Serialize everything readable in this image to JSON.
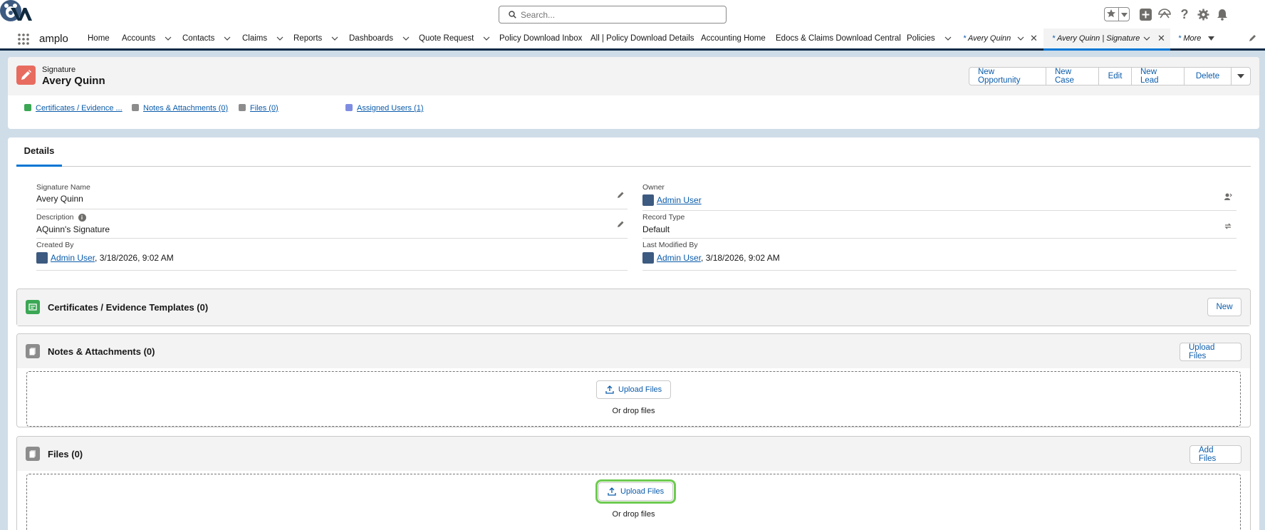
{
  "header": {
    "search_placeholder": "Search...",
    "icons": [
      "favorites-star-icon",
      "chevron-down-icon",
      "add-icon",
      "trailhead-icon",
      "help-icon",
      "setup-gear-icon",
      "notifications-bell-icon",
      "user-avatar"
    ]
  },
  "nav": {
    "app_name": "amplo",
    "items": [
      {
        "label": "Home",
        "dropdown": false
      },
      {
        "label": "Accounts",
        "dropdown": true
      },
      {
        "label": "Contacts",
        "dropdown": true
      },
      {
        "label": "Claims",
        "dropdown": true
      },
      {
        "label": "Reports",
        "dropdown": true
      },
      {
        "label": "Dashboards",
        "dropdown": true
      },
      {
        "label": "Quote Request",
        "dropdown": true
      },
      {
        "label": "Policy Download Inbox",
        "dropdown": false
      },
      {
        "label": "All | Policy Download Details",
        "dropdown": false
      },
      {
        "label": "Accounting Home",
        "dropdown": false
      },
      {
        "label": "Edocs & Claims Download Central",
        "dropdown": false
      },
      {
        "label": "Policies",
        "dropdown": true
      }
    ],
    "tabs": [
      {
        "prefix": "*",
        "label": "Avery Quinn",
        "active": false
      },
      {
        "prefix": "*",
        "label": "Avery Quinn | Signature",
        "active": true
      }
    ],
    "more_label": "More",
    "more_prefix": "*"
  },
  "record": {
    "type_label": "Signature",
    "title": "Avery Quinn",
    "actions": [
      "New Opportunity",
      "New Case",
      "Edit",
      "New Lead",
      "Delete"
    ],
    "related_links": [
      {
        "label": "Certificates / Evidence ...",
        "color": "#3ba755"
      },
      {
        "label": "Notes & Attachments (0)",
        "color": "#8c8c8c"
      },
      {
        "label": "Files (0)",
        "color": "#8c8c8c"
      },
      {
        "label": "Assigned Users (1)",
        "color": "#7f8de1"
      }
    ]
  },
  "details": {
    "tab_label": "Details",
    "signature_name": {
      "label": "Signature Name",
      "value": "Avery Quinn"
    },
    "description": {
      "label": "Description",
      "value": "AQuinn's Signature"
    },
    "created_by": {
      "label": "Created By",
      "user": "Admin User",
      "date": ", 3/18/2026, 9:02 AM"
    },
    "owner": {
      "label": "Owner",
      "user": "Admin User"
    },
    "record_type": {
      "label": "Record Type",
      "value": "Default"
    },
    "last_modified_by": {
      "label": "Last Modified By",
      "user": "Admin User",
      "date": ", 3/18/2026, 9:02 AM"
    }
  },
  "related": {
    "certificates": {
      "title": "Certificates / Evidence Templates (0)",
      "button": "New"
    },
    "notes": {
      "title": "Notes & Attachments (0)",
      "button": "Upload Files",
      "drop_button": "Upload Files",
      "drop_text": "Or drop files"
    },
    "files": {
      "title": "Files (0)",
      "button": "Add Files",
      "drop_button": "Upload Files",
      "drop_text": "Or drop files"
    }
  },
  "colors": {
    "brand_blue": "#0b5cab",
    "active_tab": "#0176d3",
    "signature_icon": "#e86b5f",
    "certificates_icon": "#3ba755",
    "highlight": "#6ecb50"
  }
}
